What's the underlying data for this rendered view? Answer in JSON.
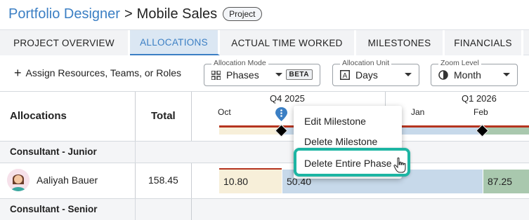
{
  "breadcrumb": {
    "parent": "Portfolio Designer",
    "separator": ">",
    "current": "Mobile Sales",
    "badge": "Project"
  },
  "tabs": [
    {
      "label": "PROJECT OVERVIEW"
    },
    {
      "label": "ALLOCATIONS"
    },
    {
      "label": "ACTUAL TIME WORKED"
    },
    {
      "label": "MILESTONES"
    },
    {
      "label": "FINANCIALS"
    }
  ],
  "toolbar": {
    "assign_plus": "+",
    "assign_label": "Assign Resources, Teams, or Roles",
    "allocation_mode": {
      "legend": "Allocation Mode",
      "value": "Phases",
      "tag": "BETA"
    },
    "allocation_unit": {
      "legend": "Allocation Unit",
      "value": "Days"
    },
    "zoom_level": {
      "legend": "Zoom Level",
      "value": "Month"
    }
  },
  "table": {
    "col_allocations": "Allocations",
    "col_total": "Total",
    "quarters": [
      "Q4 2025",
      "Q1 2026"
    ],
    "months": [
      "Oct",
      "Jan",
      "Feb"
    ],
    "groups": [
      "Consultant - Junior",
      "Consultant - Senior"
    ],
    "rows": [
      {
        "name": "Aaliyah Bauer",
        "total": "158.45",
        "cells": [
          "10.80",
          "50.40",
          "87.25"
        ]
      }
    ]
  },
  "context_menu": {
    "items": [
      "Edit Milestone",
      "Delete Milestone",
      "Delete Entire Phase"
    ]
  },
  "colors": {
    "brand_blue": "#3b7fc4",
    "highlight_teal": "#1db5a3",
    "phase_beige": "#f7efd9",
    "phase_blue": "#c7d9ea",
    "phase_green": "#a9c8ae",
    "phase_red_line": "#b5341f"
  }
}
